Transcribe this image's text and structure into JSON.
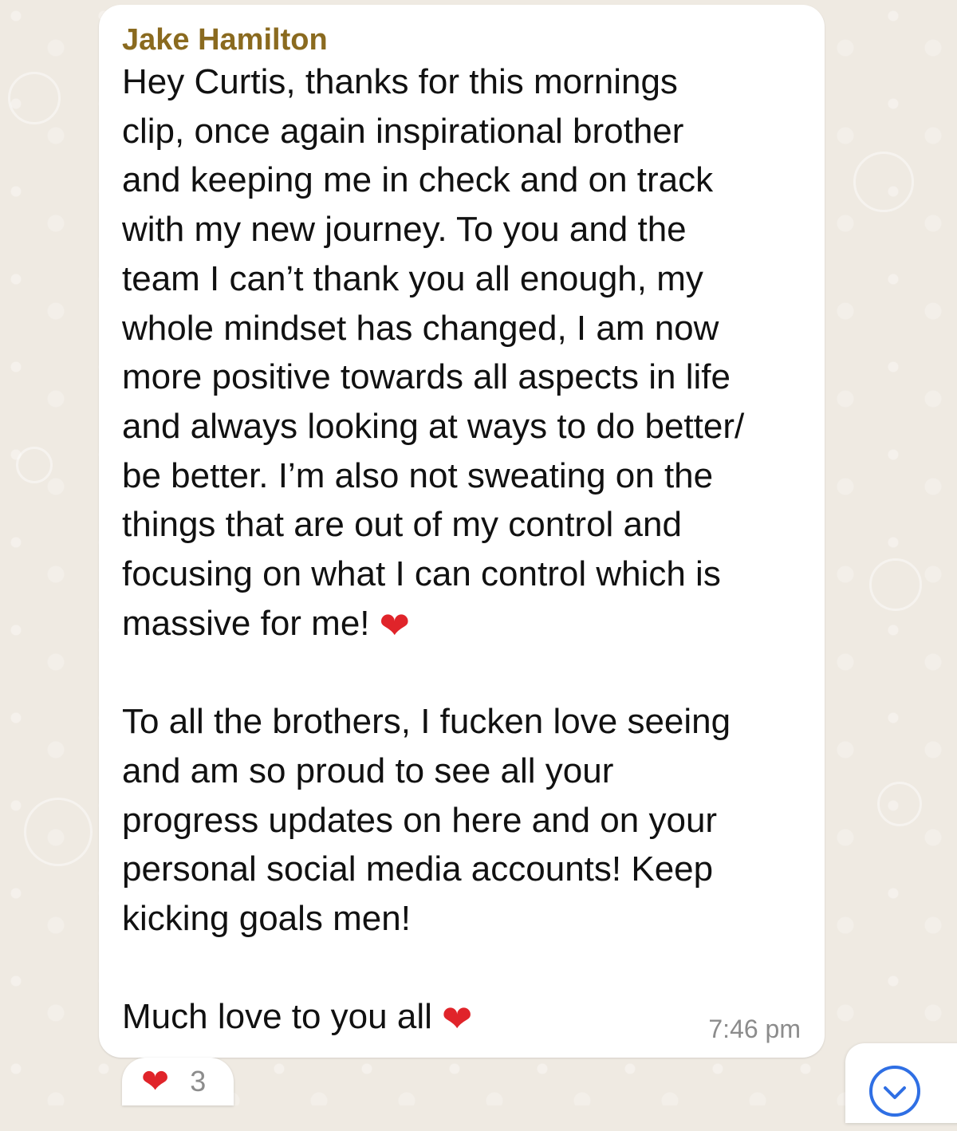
{
  "message": {
    "sender": "Jake Hamilton",
    "lines": [
      "Hey Curtis, thanks for this mornings",
      "clip, once again inspirational brother",
      "and keeping me in check and on track",
      "with my new journey. To you and the",
      "team I can’t thank you all enough, my",
      "whole mindset has changed, I am now",
      "more positive towards all aspects in life",
      "and always looking at ways to do better/",
      "be better. I’m also not sweating on the",
      "things that are out of my control and",
      "focusing on what I can control which is",
      "massive for me!"
    ],
    "heart_emoji": "❤",
    "lines2": [
      "To all the brothers, I fucken love seeing",
      "and am so proud to see all your",
      "progress updates on here and on your",
      "personal social media accounts! Keep",
      "kicking goals men!"
    ],
    "closing": "Much love to you all",
    "time": "7:46 pm"
  },
  "reaction": {
    "emoji": "❤",
    "count": "3"
  },
  "scroll_button": {
    "icon": "chevron-down-icon",
    "color": "#2f6fe4"
  },
  "colors": {
    "sender": "#8a6a1f",
    "heart": "#e0242a",
    "background": "#efeae2"
  }
}
